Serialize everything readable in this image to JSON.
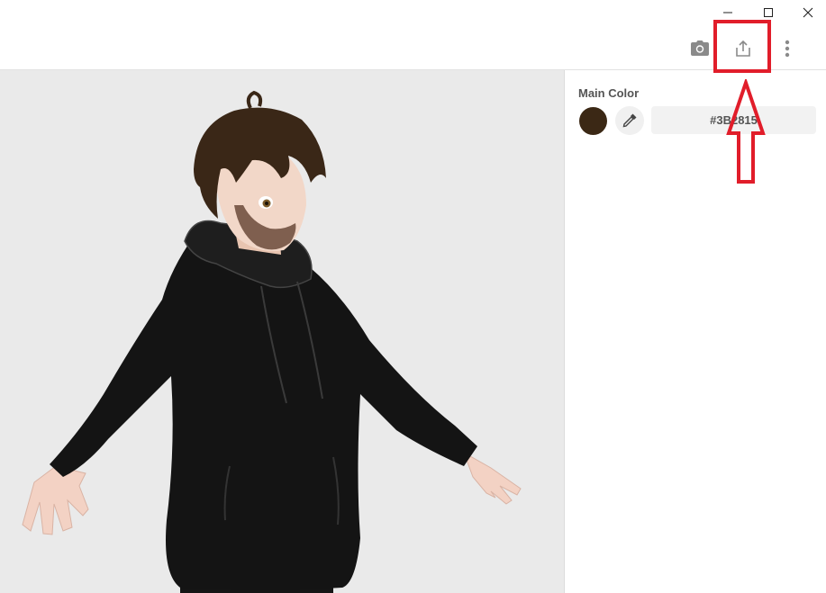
{
  "panel": {
    "label": "Main Color",
    "color_value": "#3B2815",
    "swatch_color": "#3B2815"
  },
  "icons": {
    "minimize": "minimize-icon",
    "maximize": "maximize-icon",
    "close": "close-icon",
    "camera": "camera-icon",
    "export": "export-icon",
    "more": "more-vertical-icon",
    "eyedropper": "eyedropper-icon"
  },
  "annotation": {
    "color": "#e11d2a"
  }
}
